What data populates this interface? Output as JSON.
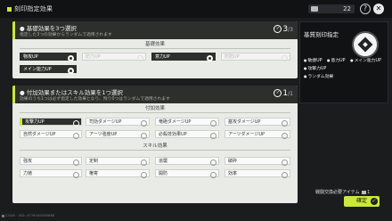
{
  "header": {
    "title": "刻印指定効果",
    "currency_value": "22"
  },
  "panel1": {
    "title": "基礎効果を3つ選択",
    "subtitle": "指定した3つの効果からランダムで適用されます",
    "count": "3",
    "count_max": "/3",
    "section": "基礎効果",
    "options": [
      "物攻UP",
      "防力UP",
      "意力UP",
      "防防UP",
      "メイン能力UP"
    ]
  },
  "panel2": {
    "title": "付加効果またはスキル効果を1つ選択",
    "subtitle": "効果のうち1つは必ず指定した効果となり、残り0つはランダムで適用されます",
    "count": "1",
    "count_max": "/1",
    "section1": "付加効果",
    "options1": [
      "攻撃力UP",
      "司効ダメージUP",
      "竜砲ダメージUP",
      "塞攻ダメージUP",
      "自然ダメージUP",
      "アーツ強度UP",
      "必殺技効果UP",
      "アーツダメージUP"
    ],
    "section2": "スキル効果",
    "options2": [
      "強攻",
      "定制",
      "追襲",
      "破砕",
      "力徳",
      "権寄",
      "開防",
      "効率"
    ]
  },
  "right": {
    "title": "基質刻印指定",
    "desc": "",
    "tags_row1": [
      "敏捷UP",
      "意力UP",
      "メイン能力UP"
    ],
    "tag_row2": "攻撃力UP",
    "tag_row3": "ランダム効果"
  },
  "bottom": {
    "required_label": "戦闘交換必要アイテム",
    "required_count": "1",
    "confirm_label": "確定"
  },
  "footer": {
    "build_text": "23/46 · UID: 4776349285868"
  }
}
